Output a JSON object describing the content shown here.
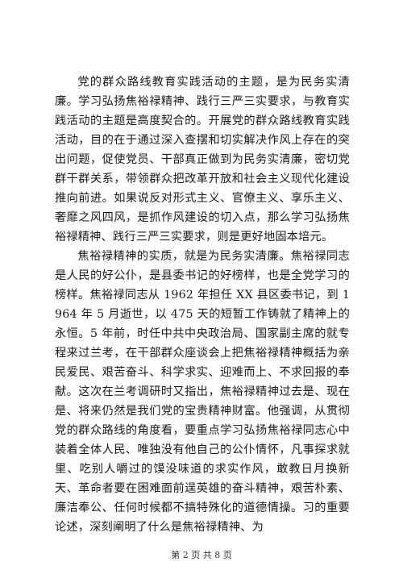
{
  "document": {
    "paragraphs": [
      "党的群众路线教育实践活动的主题，是为民务实清廉。学习弘扬焦裕禄精神、践行三严三实要求，与教育实践活动的主题是高度契合的。开展党的群众路线教育实践活动，目的在于通过深入查摆和切实解决作风上存在的突出问题，促使党员、干部真正做到为民务实清廉，密切党群干群关系，带领群众把改革开放和社会主义现代化建设推向前进。如果说反对形式主义、官僚主义、享乐主义、奢靡之风四风，是抓作风建设的切入点，那么学习弘扬焦裕禄精神、践行三严三实要求，则是更好地固本培元。",
      "焦裕禄精神的实质，就是为民务实清廉。焦裕禄同志是人民的好公仆，是县委书记的好榜样，也是全党学习的榜样。焦裕禄同志从 1962 年担任 XX 县区委书记，到 1964 年 5 月逝世，以 475 天的短暂工作铸就了精神上的永恒。5 年前，时任中共中央政治局、国家副主席的就专程来过兰考，在干部群众座谈会上把焦裕禄精神概括为亲民爱民、艰苦奋斗、科学求实、迎难而上、不求回报的奉献。这次在兰考调研时又指出，焦裕禄精神过去是、现在是、将来仍然是我们党的宝贵精神财富。他强调，从贯彻党的群众路线的角度看，要重点学习弘扬焦裕禄同志心中装着全体人民、唯独没有他自己的公仆情怀，凡事探求就里、吃别人嚼过的馍没味道的求实作风，敢教日月换新天、革命者要在困难面前逞英雄的奋斗精神，艰苦朴素、廉洁奉公、任何时候都不搞特殊化的道德情操。习的重要论述，深刻阐明了什么是焦裕禄精神、为"
    ]
  },
  "footer": {
    "page_label": "第 2 页 共 8 页"
  }
}
